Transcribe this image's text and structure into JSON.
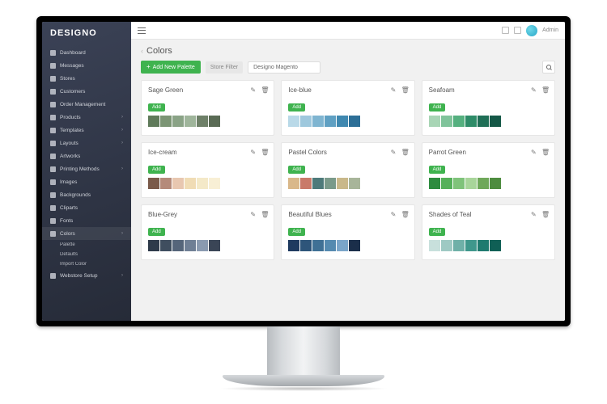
{
  "brand": "DESIGNO",
  "topbar": {
    "user_label": "Admin"
  },
  "sidebar": {
    "items": [
      {
        "label": "Dashboard"
      },
      {
        "label": "Messages"
      },
      {
        "label": "Stores"
      },
      {
        "label": "Customers"
      },
      {
        "label": "Order Management"
      },
      {
        "label": "Products",
        "expandable": true
      },
      {
        "label": "Templates",
        "expandable": true
      },
      {
        "label": "Layouts",
        "expandable": true
      },
      {
        "label": "Artworks"
      },
      {
        "label": "Printing Methods",
        "expandable": true
      },
      {
        "label": "Images"
      },
      {
        "label": "Backgrounds"
      },
      {
        "label": "Cliparts"
      },
      {
        "label": "Fonts"
      },
      {
        "label": "Colors",
        "active": true,
        "expandable": true
      },
      {
        "label": "Webstore Setup",
        "expandable": true
      }
    ],
    "colors_sub": [
      {
        "label": "Palette"
      },
      {
        "label": "Defaults"
      },
      {
        "label": "Import Color"
      }
    ]
  },
  "page": {
    "title": "Colors",
    "add_btn": "Add New Palette",
    "filter_label": "Store Filter",
    "filter_value": "Designo Magento",
    "add_badge": "Add"
  },
  "palettes": [
    {
      "name": "Sage Green",
      "colors": [
        "#5f7a5a",
        "#7b9574",
        "#8aa386",
        "#9fb59b",
        "#6e8068",
        "#5a6b55"
      ]
    },
    {
      "name": "Ice-blue",
      "colors": [
        "#b9d9e8",
        "#9ec8dd",
        "#7fb5d1",
        "#5fa0c3",
        "#3f88b0",
        "#2d6f97"
      ]
    },
    {
      "name": "Seafoam",
      "colors": [
        "#a8d5b5",
        "#7fc39a",
        "#55b07f",
        "#2e8c68",
        "#1f6f56",
        "#155847"
      ]
    },
    {
      "name": "Ice-cream",
      "colors": [
        "#7a5a4a",
        "#b58a7a",
        "#e8c7b0",
        "#f0dcb5",
        "#f4e9c8",
        "#f8efd5"
      ]
    },
    {
      "name": "Pastel Colors",
      "colors": [
        "#d9b88a",
        "#c97a6a",
        "#4e7a7a",
        "#7a9a8a",
        "#c9b88a",
        "#a8b59a"
      ]
    },
    {
      "name": "Parrot Green",
      "colors": [
        "#2e8c3f",
        "#55b05a",
        "#7fc37a",
        "#a8d59a",
        "#6fa85a",
        "#4e8c3f"
      ]
    },
    {
      "name": "Blue-Grey",
      "colors": [
        "#2e3a4a",
        "#3f4e5f",
        "#55657a",
        "#6f7f95",
        "#8a9ab0",
        "#3a4556"
      ]
    },
    {
      "name": "Beautiful Blues",
      "colors": [
        "#1f3a5f",
        "#2e557a",
        "#3f7095",
        "#558ab0",
        "#7aa5c9",
        "#1a2e4a"
      ]
    },
    {
      "name": "Shades of Teal",
      "colors": [
        "#c8e0dc",
        "#9ec9c3",
        "#6fb0a8",
        "#3f978c",
        "#1f7a6f",
        "#0f5f55"
      ]
    }
  ]
}
